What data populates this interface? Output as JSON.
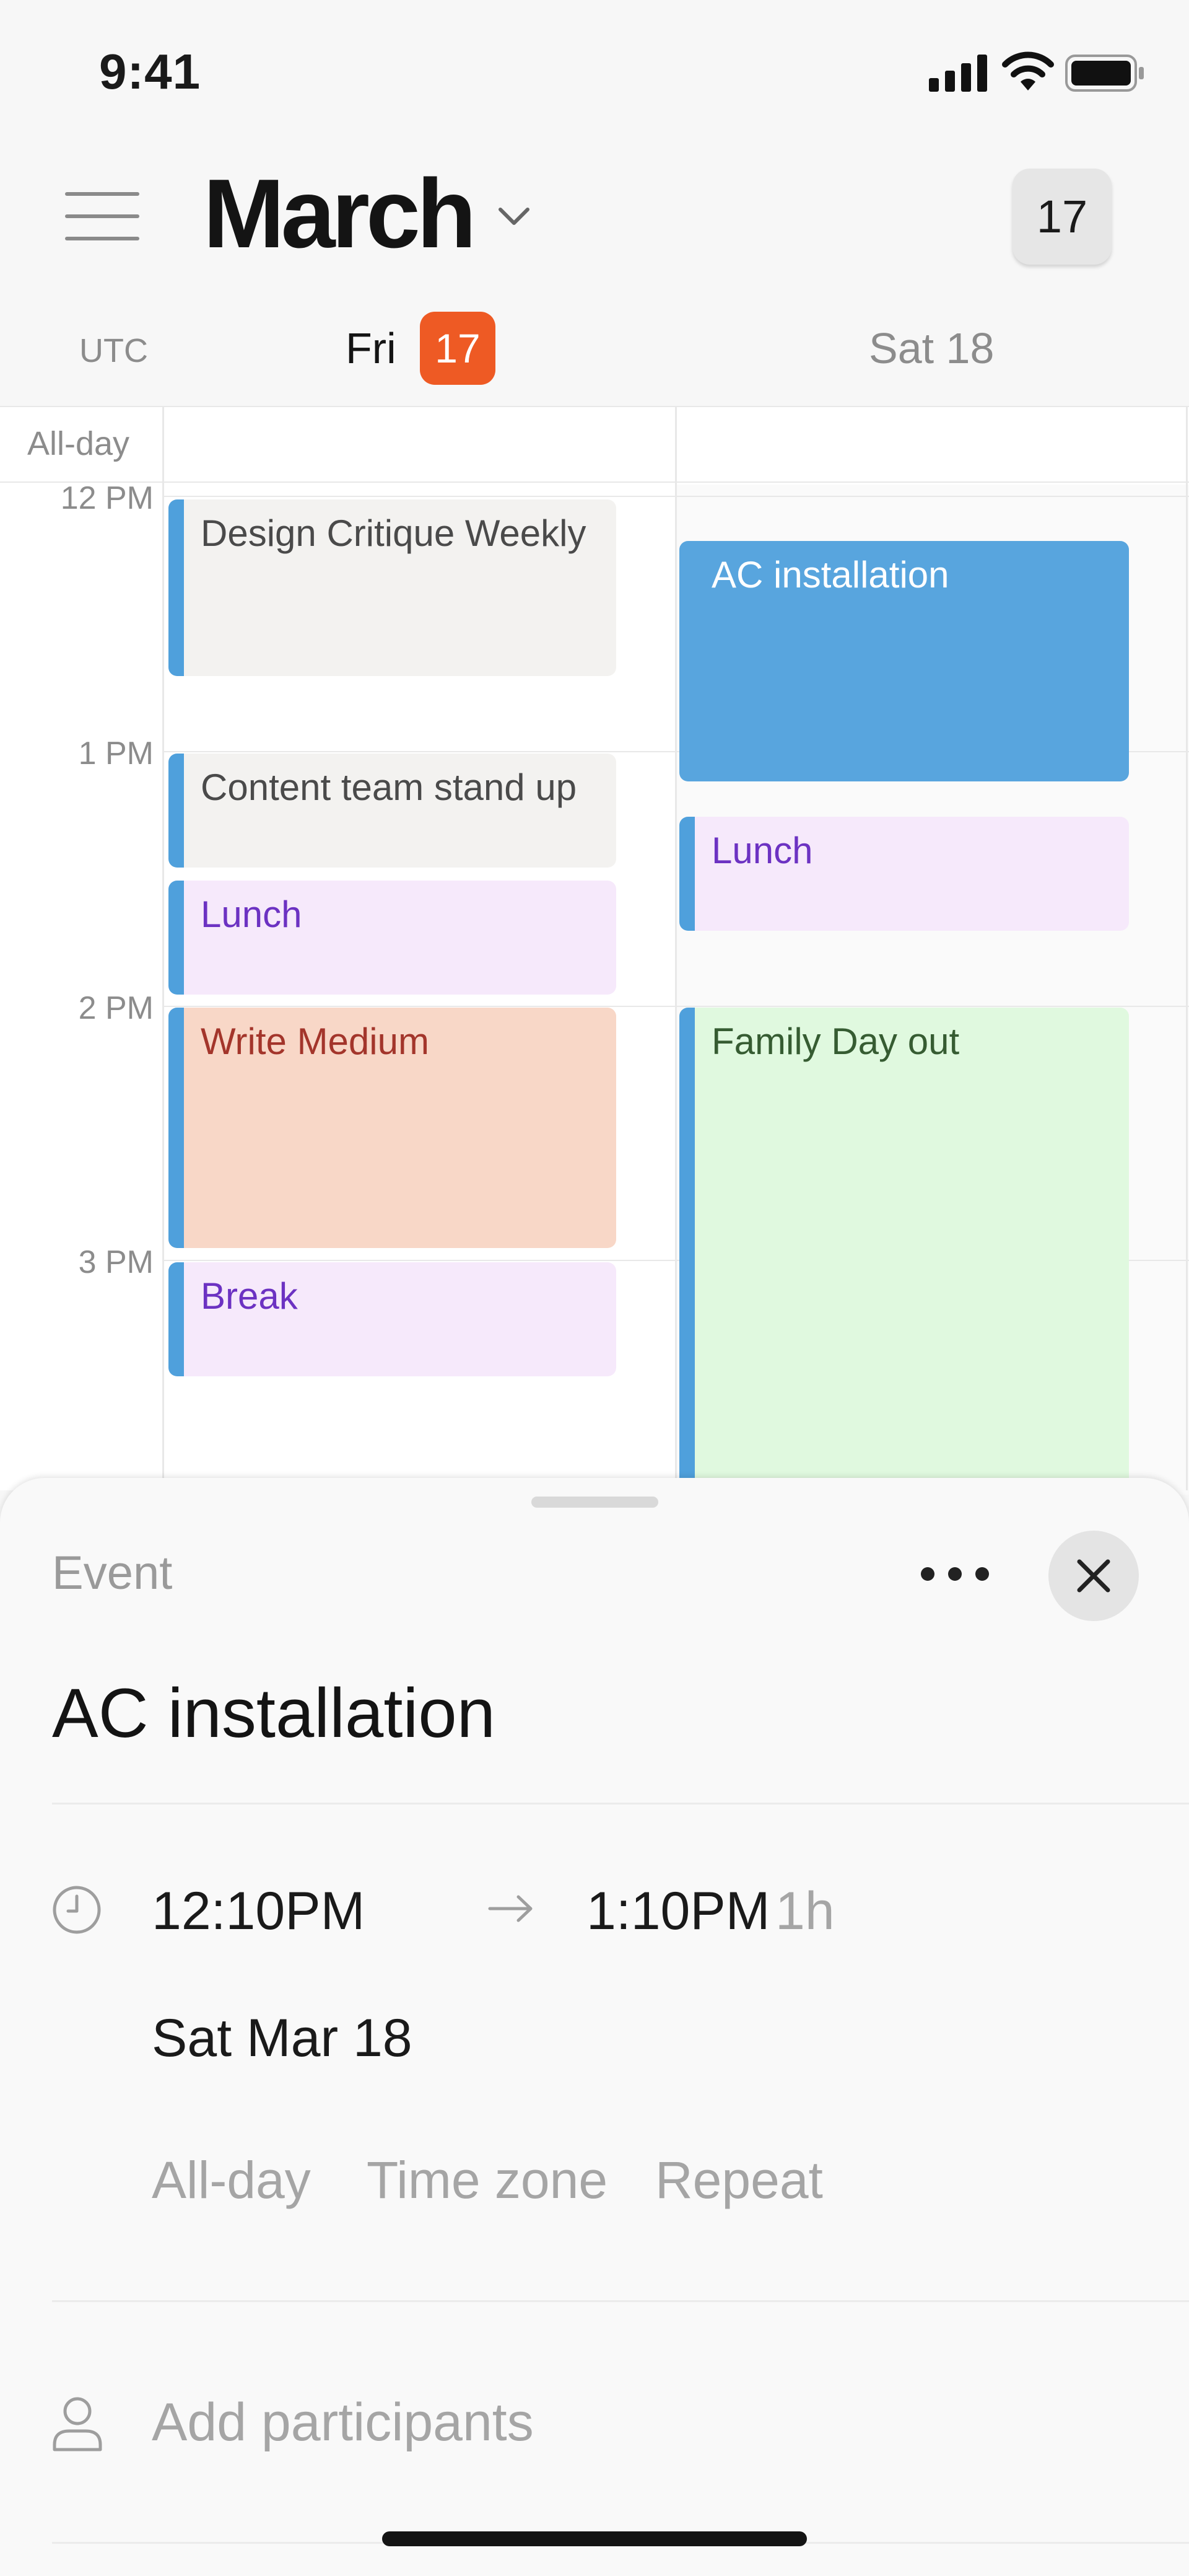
{
  "status_bar": {
    "time": "9:41"
  },
  "header": {
    "month": "March",
    "today_button": "17"
  },
  "day_header": {
    "timezone": "UTC",
    "day1_name": "Fri",
    "day1_date": "17",
    "day2": "Sat 18"
  },
  "grid": {
    "allday_label": "All-day",
    "time_labels": [
      "12 PM",
      "1 PM",
      "2 PM",
      "3 PM"
    ]
  },
  "events": {
    "fri": [
      {
        "title": "Design Critique Weekly"
      },
      {
        "title": "Content team stand up"
      },
      {
        "title": "Lunch"
      },
      {
        "title": "Write Medium"
      },
      {
        "title": "Break"
      }
    ],
    "sat": [
      {
        "title": "AC installation"
      },
      {
        "title": "Lunch"
      },
      {
        "title": "Family Day out"
      }
    ]
  },
  "colors": {
    "accent_bar": "#4fa0dc",
    "today_badge": "#ee5a24",
    "gray_event": "#f3f2f0",
    "purple_event": "#f6e9fb",
    "purple_text": "#6c32c2",
    "salmon_event": "#f8d7c7",
    "salmon_text": "#a3352b",
    "blue_event": "#58a5de",
    "green_event": "#e0f9df",
    "green_text": "#365c32"
  },
  "sheet": {
    "label": "Event",
    "title": "AC installation",
    "start_time": "12:10PM",
    "end_time": "1:10PM",
    "duration": "1h",
    "date": "Sat Mar 18",
    "options": [
      "All-day",
      "Time zone",
      "Repeat"
    ],
    "participants_placeholder": "Add participants"
  }
}
